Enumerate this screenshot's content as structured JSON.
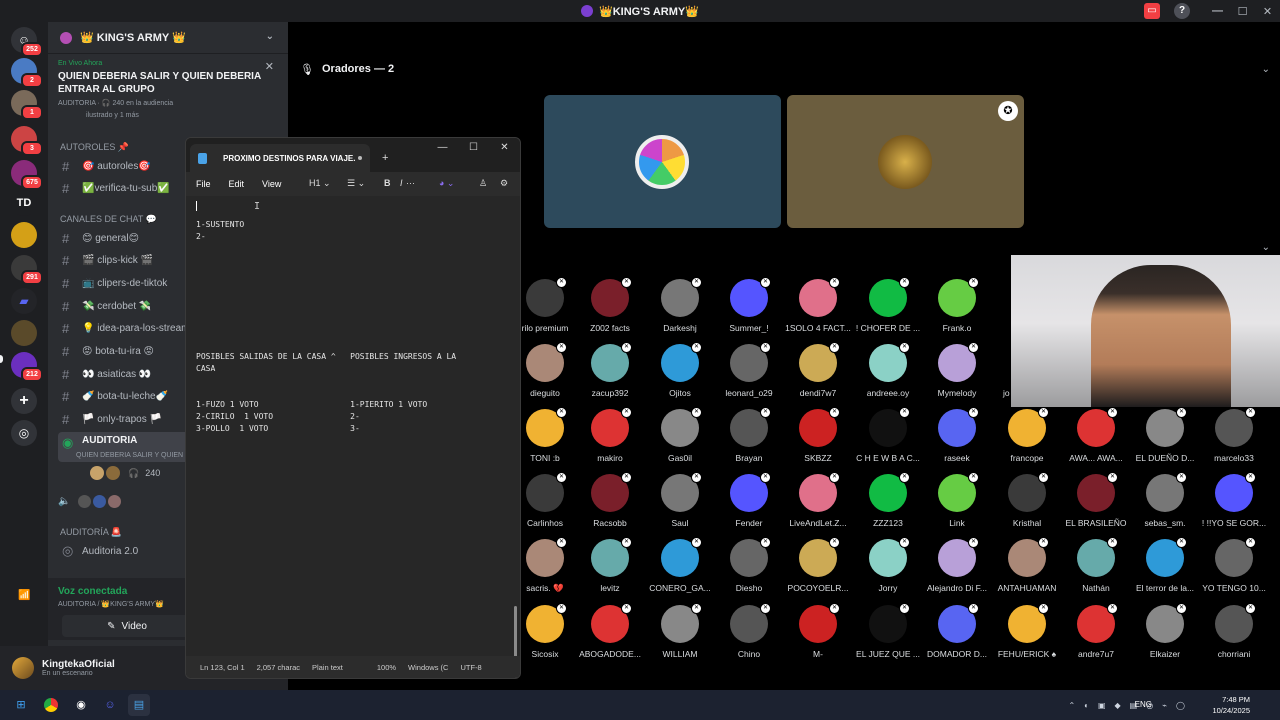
{
  "window": {
    "title": "👑KING'S ARMY👑"
  },
  "rail": {
    "badges": [
      "252",
      "2",
      "1",
      "3",
      "675",
      "291",
      "212"
    ],
    "td_label": "TD"
  },
  "server": {
    "name": "👑 KING'S ARMY 👑"
  },
  "live_banner": {
    "tag": "En Vivo Ahora",
    "title": "QUIEN DEBERIA SALIR Y QUIEN DEBERIA ENTRAR AL GRUPO",
    "meta": "AUDITORIA · 🎧 240 en la audiencia",
    "meta2": "ilustrado y 1 más"
  },
  "categories": {
    "autoroles": "AUTOROLES 📌",
    "chat": "CANALES DE CHAT 💬",
    "auditoria": "AUDITORÍA 🚨"
  },
  "channels": [
    "🎯 autoroles🎯",
    "✅verifica-tu-sub✅",
    "😊 general😊",
    "🎬 clips-kick 🎬",
    "📺 clipers-de-tiktok",
    "💸 cerdobet 💸",
    "💡 idea-para-los-stream",
    "😡 bota-tu-ira 😡",
    "👀 asiaticas 👀",
    "🍼 bota-tu-leche🍼",
    "🏳️ only-trapos 🏳️"
  ],
  "stage_channel": {
    "name": "AUDITORIA",
    "sub": "QUIEN DEBERIA SALIR Y QUIEN",
    "count": "240"
  },
  "auditoria2": "Auditoria 2.0",
  "voice": {
    "status": "Voz conectada",
    "location": "AUDITORIA / 👑KING'S ARMY👑",
    "video_label": "Video"
  },
  "user": {
    "name": "KingtekaOficial",
    "status": "En un escenario"
  },
  "stage": {
    "speakers_label": "Oradores — 2"
  },
  "audience": [
    [
      "rilo premium",
      "Z002 facts",
      "Darkeshj",
      "Summer_!",
      "1SOLO 4 FACT...",
      "! CHOFER DE ...",
      "Frank.o"
    ],
    [
      "dieguito",
      "zacup392",
      "Ojitos",
      "leonard_o29",
      "dendi7w7",
      "andreee.oy",
      "Mymelody"
    ],
    [
      "TONI :b",
      "makiro",
      "Gas0il",
      "Brayan",
      "SKBZZ",
      "C H E W B A C...",
      "raseek",
      "francope",
      "AWA... AWA...",
      "EL DUEÑO D...",
      "marcelo33"
    ],
    [
      "Carlinhos",
      "Racsobb",
      "Saul",
      "Fender",
      "LiveAndLet.Z...",
      "ZZZ123",
      "Link",
      "Kristhal",
      "EL BRASILEÑO",
      "sebas_sm.",
      "! !!YO SE GOR..."
    ],
    [
      "sacris. 💔",
      "levitz",
      "CONERO_GA...",
      "Diesho",
      "POCOYOELR...",
      "Jorry",
      "Alejandro Di F...",
      "ANTAHUAMAN",
      "Nathán",
      "El terror de la...",
      "YO TENGO 10..."
    ],
    [
      "Sicosix",
      "ABOGADODE...",
      "WILLIAM",
      "Chino",
      "M-",
      "EL JUEZ QUE ...",
      "DOMADOR D...",
      "FEHU/ERICK ♠",
      "andre7u7",
      "Elkaizer",
      "chorriani"
    ]
  ],
  "extra_name": "jo",
  "notepad": {
    "tab_title": "PROXIMO DESTINOS PARA VIAJE.",
    "menu": [
      "File",
      "Edit",
      "View"
    ],
    "heading": "H1",
    "lines": [
      "1-SUSTENTO",
      "2-",
      "POSIBLES SALIDAS DE LA CASA ^   POSIBLES INGRESOS A LA",
      "CASA",
      "1-FUZO 1 VOTO                   1-PIERITO 1 VOTO",
      "2-CIRILO  1 VOTO                2-",
      "3-POLLO  1 VOTO                 3-"
    ],
    "status": [
      "Ln 123, Col 1",
      "2,057 charac",
      "Plain text",
      "100%",
      "Windows (C",
      "UTF-8"
    ]
  },
  "taskbar": {
    "time": "7:48 PM",
    "date": "10/24/2025",
    "lang": "ENG"
  }
}
